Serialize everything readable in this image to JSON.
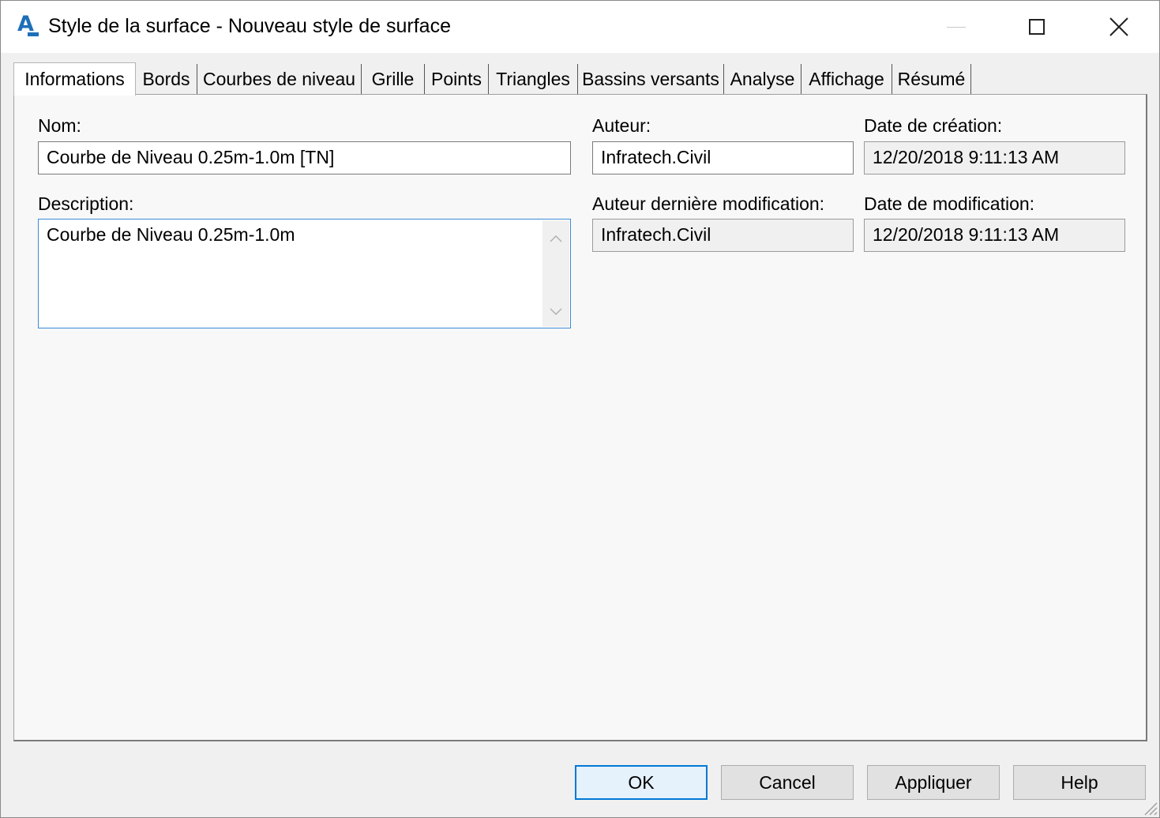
{
  "window": {
    "title": "Style de la surface - Nouveau style de surface",
    "app_icon_letter": "A",
    "accent_color": "#0078d7"
  },
  "tabs": [
    {
      "label": "Informations",
      "active": true
    },
    {
      "label": "Bords",
      "active": false
    },
    {
      "label": "Courbes de niveau",
      "active": false
    },
    {
      "label": "Grille",
      "active": false
    },
    {
      "label": "Points",
      "active": false
    },
    {
      "label": "Triangles",
      "active": false
    },
    {
      "label": "Bassins versants",
      "active": false
    },
    {
      "label": "Analyse",
      "active": false
    },
    {
      "label": "Affichage",
      "active": false
    },
    {
      "label": "Résumé",
      "active": false
    }
  ],
  "form": {
    "name_label": "Nom:",
    "name_value": "Courbe de Niveau 0.25m-1.0m [TN]",
    "description_label": "Description:",
    "description_value": "Courbe de Niveau 0.25m-1.0m",
    "author_label": "Auteur:",
    "author_value": "Infratech.Civil",
    "created_label": "Date de création:",
    "created_value": "12/20/2018 9:11:13 AM",
    "last_author_label": "Auteur dernière modification:",
    "last_author_value": "Infratech.Civil",
    "modified_label": "Date de modification:",
    "modified_value": "12/20/2018 9:11:13 AM"
  },
  "buttons": {
    "ok": "OK",
    "cancel": "Cancel",
    "apply": "Appliquer",
    "help": "Help"
  }
}
